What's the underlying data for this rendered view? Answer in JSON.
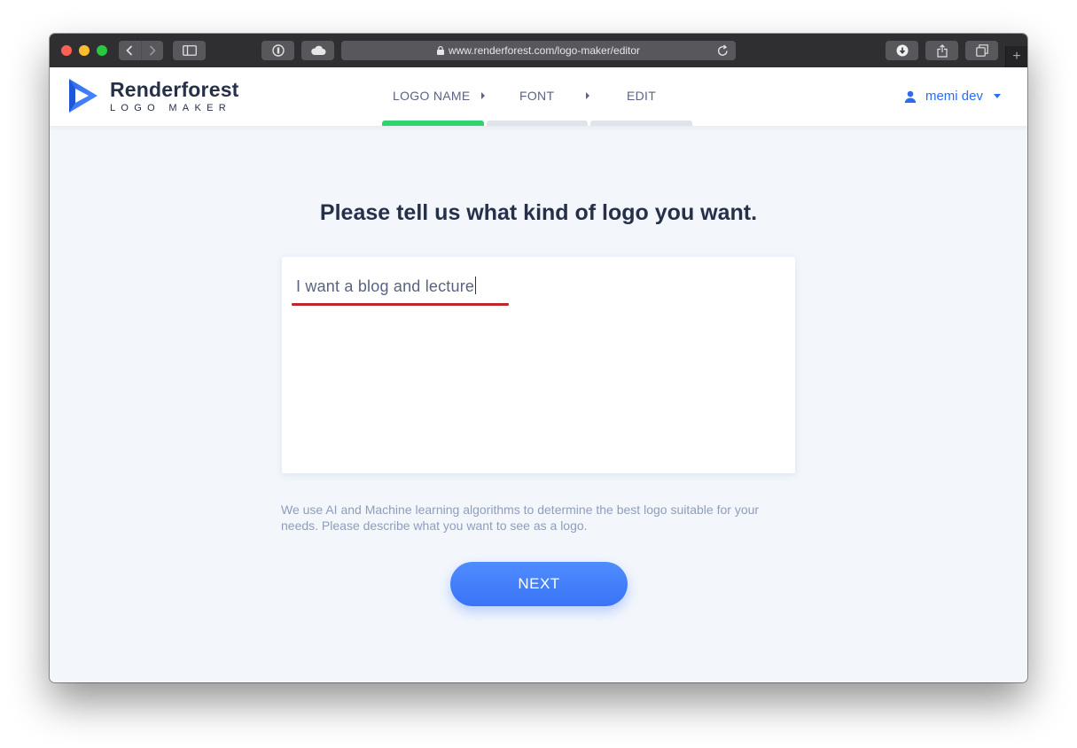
{
  "browser": {
    "url": "www.renderforest.com/logo-maker/editor"
  },
  "brand": {
    "name": "Renderforest",
    "subtitle": "LOGO MAKER",
    "accent": "#2b6cf2"
  },
  "steps": [
    {
      "label": "LOGO NAME",
      "status": "active",
      "color": "#2fd36f"
    },
    {
      "label": "FONT",
      "status": "pending",
      "color": "#dfe3ea"
    },
    {
      "label": "EDIT",
      "status": "pending",
      "color": "#dfe3ea"
    }
  ],
  "user": {
    "name": "memi dev"
  },
  "main": {
    "title": "Please tell us what kind of logo you want.",
    "input_value": "I want a blog and lecture",
    "help_text": "We use AI and Machine learning algorithms to determine the best logo suitable for your needs. Please describe what you want to see as a logo.",
    "next_label": "NEXT"
  }
}
